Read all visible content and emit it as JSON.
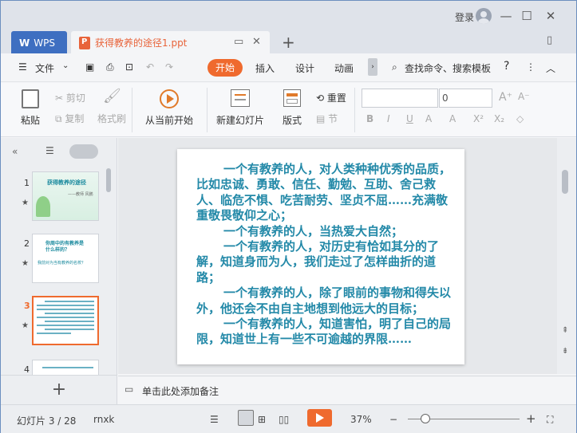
{
  "titlebar": {
    "login": "登录",
    "minimize": "—",
    "maximize": "☐",
    "close": "✕"
  },
  "tabs": {
    "app": "WPS",
    "doc": "获得教养的途径1.ppt",
    "new": "+"
  },
  "menu": {
    "file": "文件",
    "start": "开始",
    "insert": "插入",
    "design": "设计",
    "animation": "动画",
    "search": "查找命令、搜索模板",
    "help": "?"
  },
  "ribbon": {
    "paste": "粘贴",
    "cut": "剪切",
    "copy": "复制",
    "format_painter": "格式刷",
    "play_current": "从当前开始",
    "new_slide": "新建幻灯片",
    "layout": "版式",
    "reset": "重置",
    "section": "节",
    "font_size": "0"
  },
  "slides": {
    "current_index": 3,
    "thumb1_title": "获得教养的途径",
    "thumb1_sub": "——教师 风鹏",
    "thumb2_line1": "你周中的有教养是",
    "thumb2_line2": "什么样的？",
    "thumb2_line3": "我前对为当有教养的名校？"
  },
  "slide_text": [
    "一个有教养的人，对人类种种优秀的品质，比如忠诚、勇敢、信任、勤勉、互助、舍己救人、临危不惧、吃苦耐劳、坚贞不屈……充满敬重敬畏敬仰之心；",
    "一个有教养的人，当热爱大自然；",
    "一个有教养的人，对历史有恰如其分的了解，知道身而为人，我们走过了怎样曲折的道路；",
    "一个有教养的人，除了眼前的事物和得失以外，他还会不由自主地想到他远大的目标；",
    "一个有教养的人，知道害怕，明了自己的局限，知道世上有一些不可逾越的界限……"
  ],
  "notes": {
    "placeholder": "单击此处添加备注"
  },
  "status": {
    "slide_counter": "幻灯片 3 / 28",
    "theme": "rnxk",
    "zoom": "37%",
    "zoom_minus": "−",
    "zoom_plus": "+"
  },
  "colors": {
    "accent": "#ef6a2e",
    "tab_blue": "#3e6fc1",
    "slide_text": "#2389a8"
  }
}
